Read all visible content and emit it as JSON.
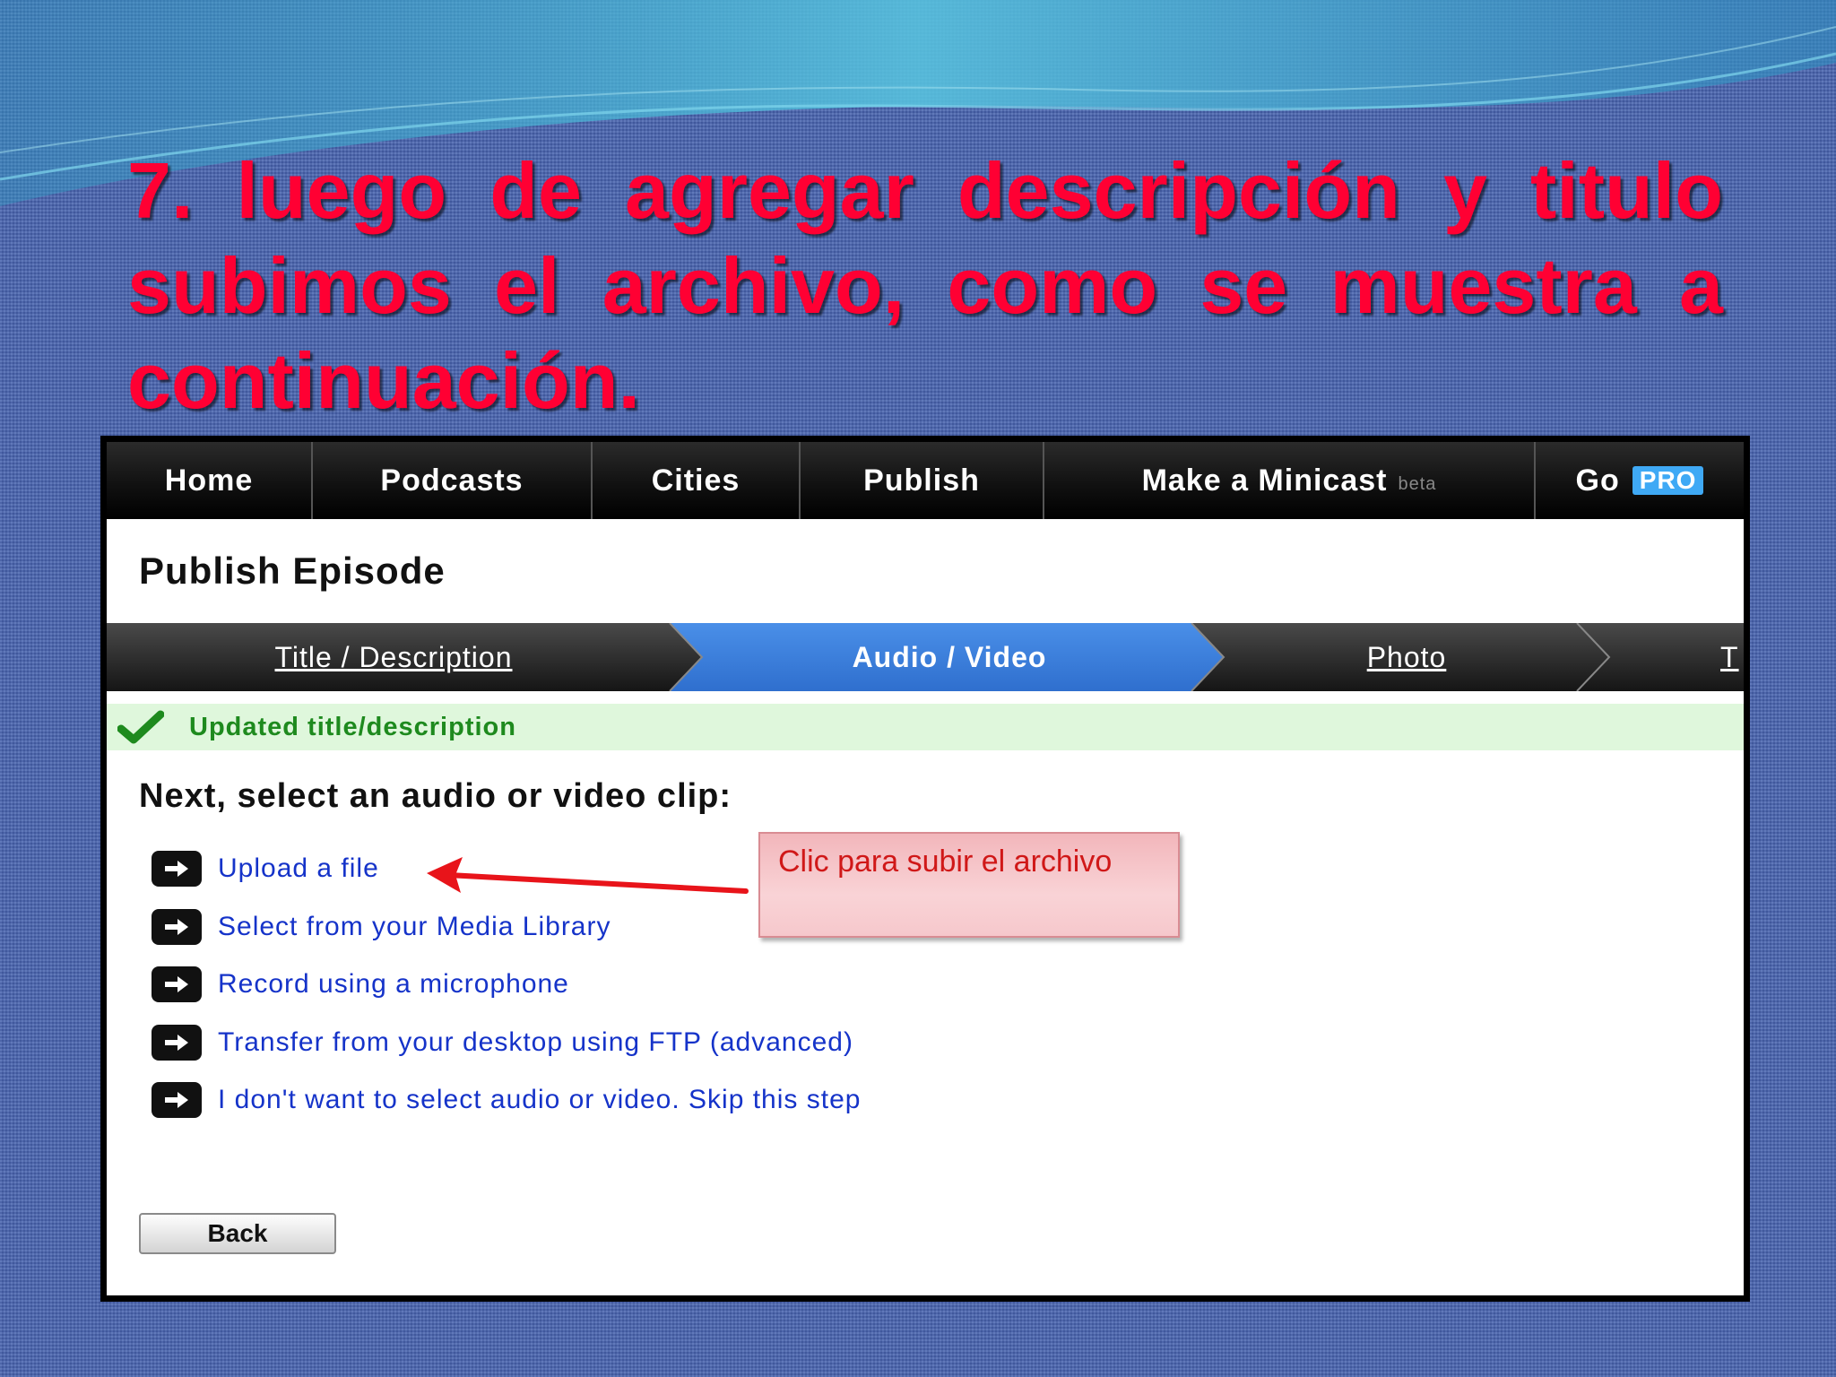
{
  "slide": {
    "title": "7. luego de agregar descripción y titulo subimos el archivo, como se muestra a continuación.",
    "callout": "Clic para subir el archivo"
  },
  "nav": {
    "items": [
      "Home",
      "Podcasts",
      "Cities",
      "Publish",
      "Make a Minicast",
      "Go"
    ],
    "beta_badge": "beta",
    "pro_badge": "PRO"
  },
  "page": {
    "title": "Publish Episode",
    "wizard_steps": [
      "Title / Description",
      "Audio / Video",
      "Photo",
      "T"
    ],
    "active_step": "Audio / Video",
    "status_message": "Updated title/description",
    "prompt": "Next, select an audio or video clip:",
    "options": [
      "Upload a file",
      "Select from your Media Library",
      "Record using a microphone",
      "Transfer from your desktop using FTP (advanced)",
      "I don't want to select audio or video.  Skip this step"
    ],
    "back_label": "Back"
  },
  "colors": {
    "background": "#4a66b0",
    "title_text": "#ff0033",
    "active_step": "#3d7fdc",
    "status_bg": "#dff7dc",
    "status_text": "#1e8a1e",
    "link": "#1533c9",
    "callout_text": "#d01818"
  },
  "icons": {
    "status": "checkmark-icon",
    "option": "arrow-right-icon",
    "annotation": "red-arrow"
  }
}
